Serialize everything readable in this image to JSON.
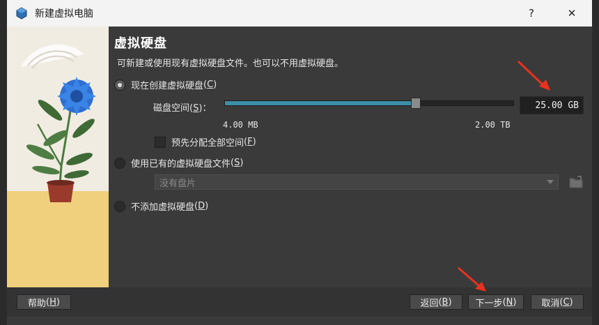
{
  "window": {
    "title": "新建虚拟电脑",
    "help_glyph": "?",
    "close_glyph": "✕"
  },
  "page": {
    "heading": "虚拟硬盘",
    "description": "可新建或使用现有虚拟硬盘文件。也可以不用虚拟硬盘。"
  },
  "options": {
    "create": {
      "label": "现在创建虚拟硬盘",
      "shortcut": "C",
      "selected": true
    },
    "existing": {
      "label": "使用已有的虚拟硬盘文件",
      "shortcut": "S",
      "selected": false
    },
    "none": {
      "label": "不添加虚拟硬盘",
      "shortcut": "D",
      "selected": false
    }
  },
  "disk": {
    "size_label": "磁盘空间",
    "size_shortcut": "S",
    "size_colon": "：",
    "size_value": "25.00 GB",
    "min_label": "4.00 MB",
    "max_label": "2.00 TB",
    "slider_position": 0.66,
    "prealloc_label": "预先分配全部空间",
    "prealloc_shortcut": "F",
    "prealloc_checked": false
  },
  "existing_disk": {
    "placeholder": "没有盘片"
  },
  "buttons": {
    "help": {
      "label": "帮助",
      "shortcut": "H"
    },
    "back": {
      "label": "返回",
      "shortcut": "B"
    },
    "next": {
      "label": "下一步",
      "shortcut": "N"
    },
    "cancel": {
      "label": "取消",
      "shortcut": "C"
    }
  },
  "colors": {
    "accent": "#3d8fa8",
    "annotation_arrow": "#e8321e"
  }
}
